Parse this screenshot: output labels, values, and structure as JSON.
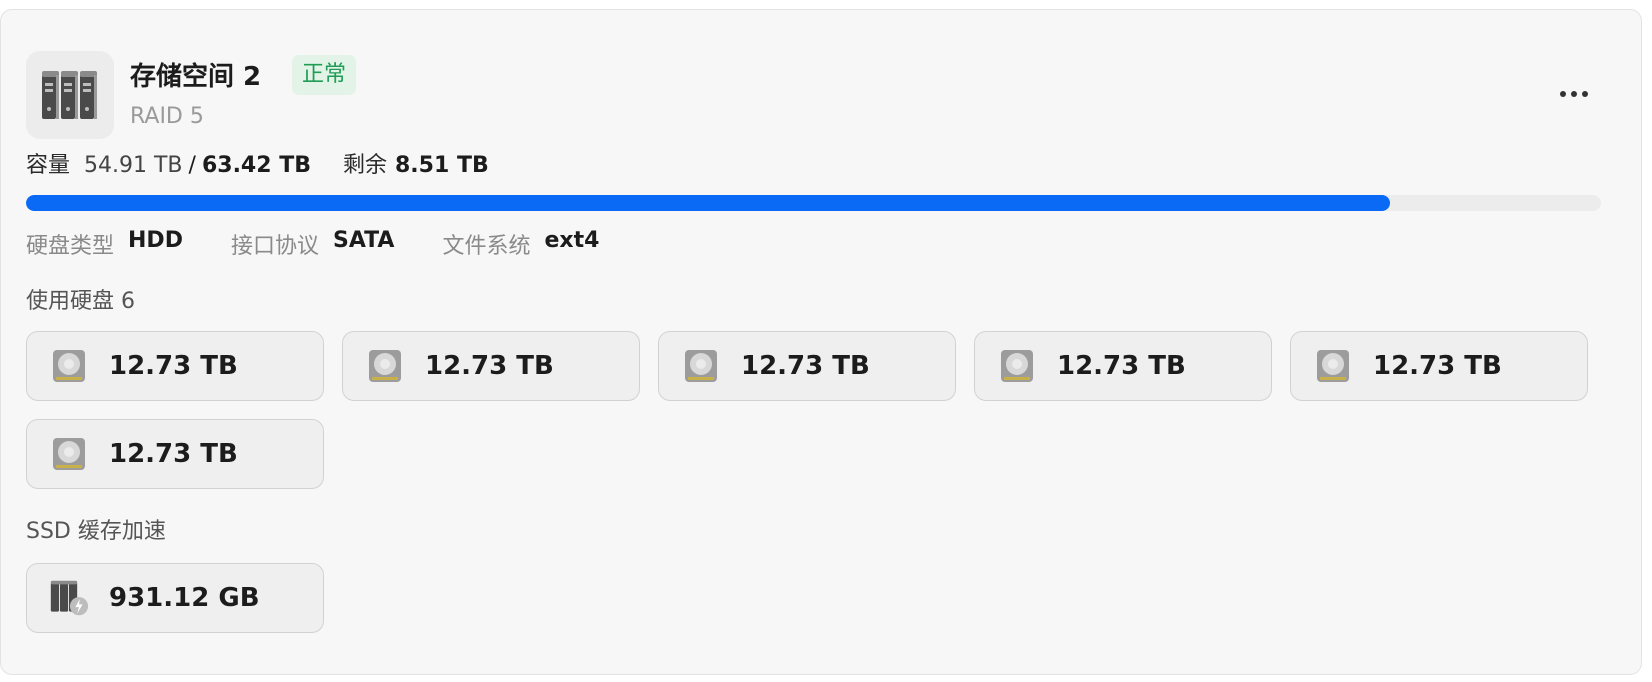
{
  "pool": {
    "icon": "server-rack-icon",
    "title": "存储空间 2",
    "status": "正常",
    "status_color": "#1f9d55",
    "raid_level": "RAID 5",
    "more_icon": "more-dots-icon"
  },
  "capacity": {
    "label": "容量",
    "used": "54.91 TB",
    "separator": "/",
    "total": "63.42 TB",
    "remaining_label": "剩余",
    "remaining": "8.51 TB",
    "used_fraction": 0.866,
    "bar_color": "#0a6af5"
  },
  "specs": [
    {
      "key": "硬盘类型",
      "value": "HDD"
    },
    {
      "key": "接口协议",
      "value": "SATA"
    },
    {
      "key": "文件系统",
      "value": "ext4"
    }
  ],
  "disks_section": {
    "label": "使用硬盘 6",
    "disks": [
      {
        "icon": "hard-disk-icon",
        "size": "12.73 TB"
      },
      {
        "icon": "hard-disk-icon",
        "size": "12.73 TB"
      },
      {
        "icon": "hard-disk-icon",
        "size": "12.73 TB"
      },
      {
        "icon": "hard-disk-icon",
        "size": "12.73 TB"
      },
      {
        "icon": "hard-disk-icon",
        "size": "12.73 TB"
      },
      {
        "icon": "hard-disk-icon",
        "size": "12.73 TB"
      }
    ]
  },
  "ssd_section": {
    "label": "SSD 缓存加速",
    "cache": {
      "icon": "ssd-cache-icon",
      "size": "931.12 GB"
    }
  }
}
